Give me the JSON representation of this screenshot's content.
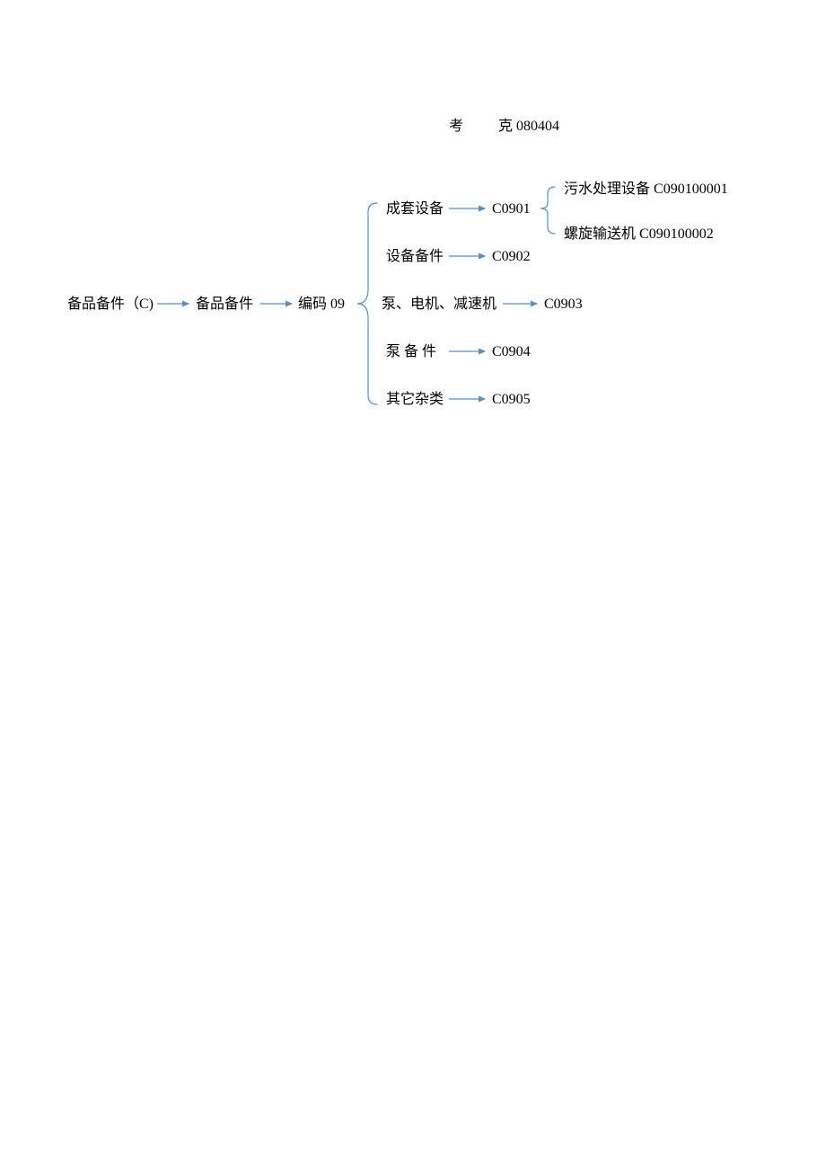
{
  "header": {
    "kao": "考",
    "ke_code": "克 080404"
  },
  "root": {
    "spare_parts_c": "备品备件（C)",
    "spare_parts": "备品备件",
    "code09": "编码 09"
  },
  "branches": {
    "complete_set": {
      "label": "成套设备",
      "code": "C0901"
    },
    "equip_parts": {
      "label": "设备备件",
      "code": "C0902"
    },
    "pump_motor": {
      "label": "泵、电机、减速机",
      "code": "C0903"
    },
    "pump_parts": {
      "label": "泵 备 件",
      "code": "C0904"
    },
    "other_misc": {
      "label": "其它杂类",
      "code": "C0905"
    }
  },
  "leaves": {
    "sewage": {
      "label": "污水处理设备",
      "code": "C090100001"
    },
    "screw": {
      "label": "螺旋输送机",
      "code": "C090100002"
    }
  }
}
